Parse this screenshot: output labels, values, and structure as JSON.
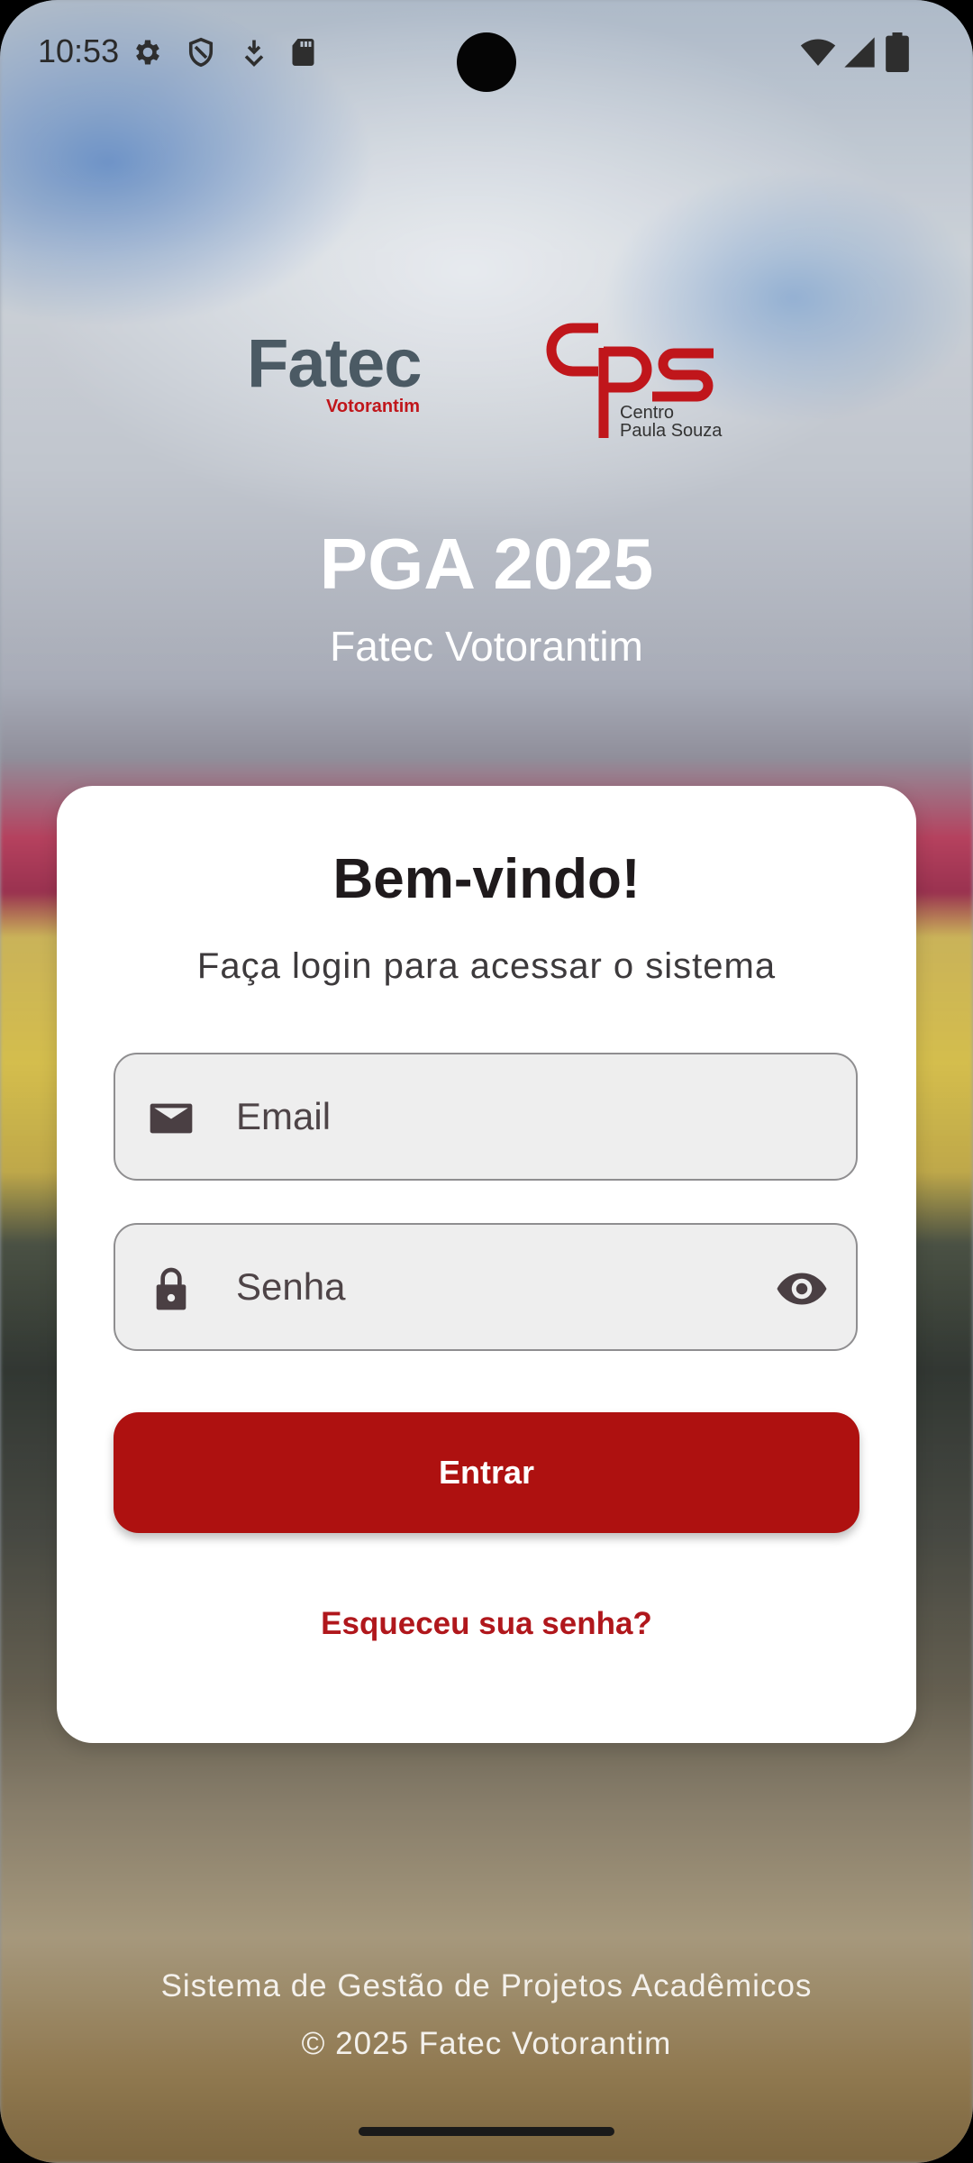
{
  "status_bar": {
    "time": "10:53",
    "icons": [
      "settings-icon",
      "shield-icon",
      "download-arrow-icon",
      "sd-card-icon",
      "wifi-icon",
      "signal-icon",
      "battery-icon"
    ]
  },
  "logos": {
    "fatec_word": "Fatec",
    "fatec_sub": "Votorantim",
    "cps_line1": "Centro",
    "cps_line2": "Paula Souza"
  },
  "header": {
    "title": "PGA 2025",
    "subtitle": "Fatec Votorantim"
  },
  "login_card": {
    "title": "Bem-vindo!",
    "subtitle": "Faça login para acessar o sistema",
    "email_placeholder": "Email",
    "password_placeholder": "Senha",
    "login_button": "Entrar",
    "forgot_link": "Esqueceu sua senha?"
  },
  "footer": {
    "line1": "Sistema de Gestão de Projetos Acadêmicos",
    "line2": "© 2025 Fatec Votorantim"
  },
  "colors": {
    "accent": "#ae1110",
    "link": "#b0171c",
    "card_background": "#ffffff",
    "field_background": "#eeeeee"
  }
}
